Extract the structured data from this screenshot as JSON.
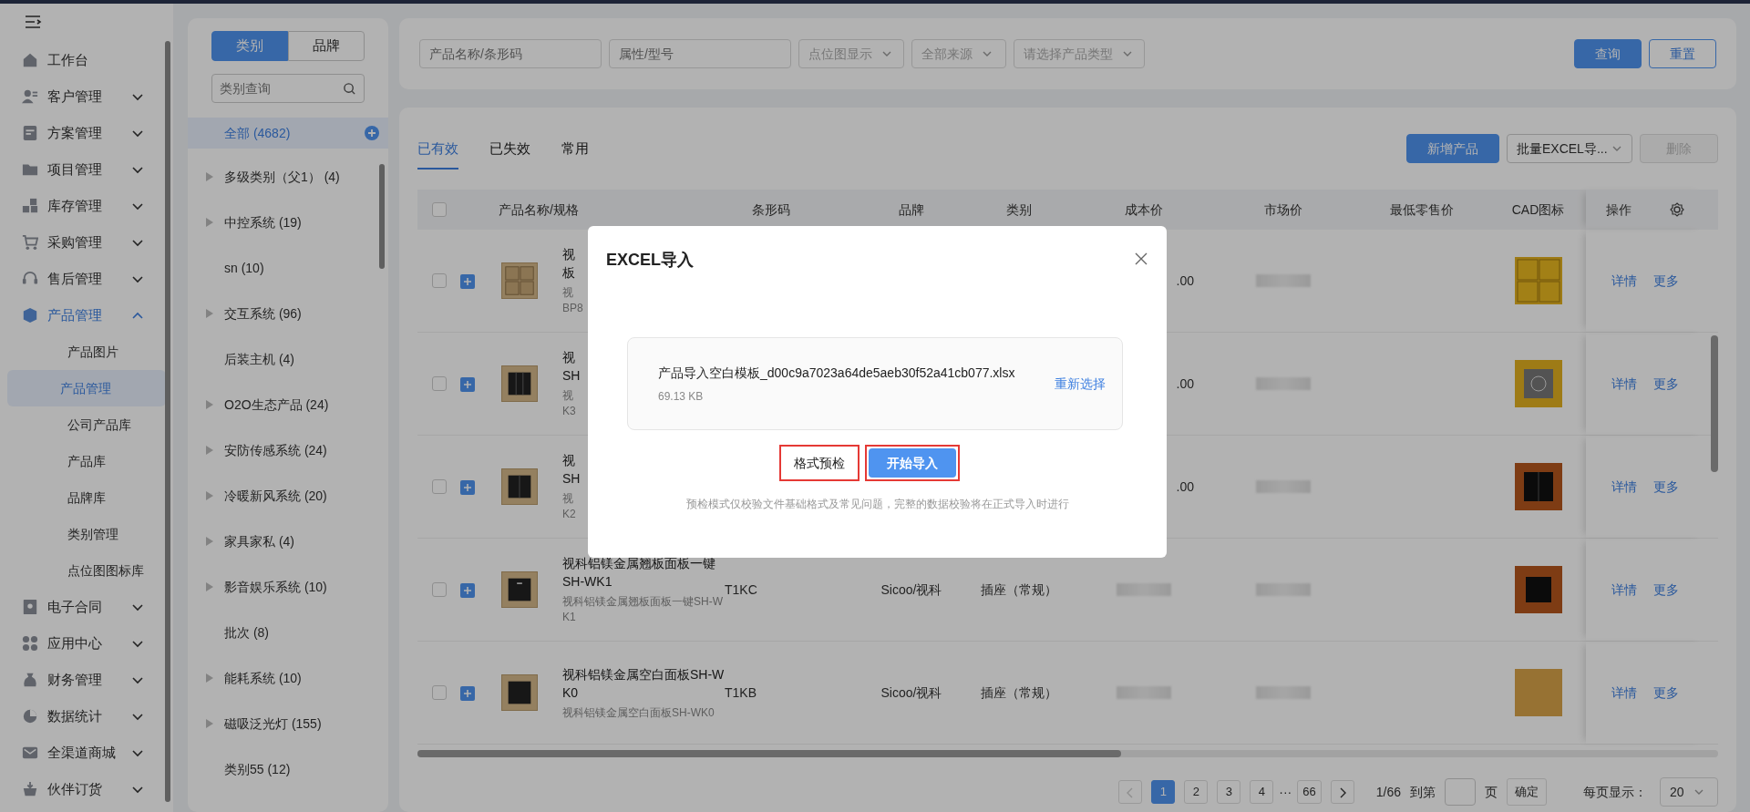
{
  "sidebar": {
    "items": [
      {
        "label": "工作台",
        "expandable": false,
        "active": false
      },
      {
        "label": "客户管理",
        "expandable": true,
        "expanded": false,
        "active": false
      },
      {
        "label": "方案管理",
        "expandable": true,
        "expanded": false,
        "active": false
      },
      {
        "label": "项目管理",
        "expandable": true,
        "expanded": false,
        "active": false
      },
      {
        "label": "库存管理",
        "expandable": true,
        "expanded": false,
        "active": false
      },
      {
        "label": "采购管理",
        "expandable": true,
        "expanded": false,
        "active": false
      },
      {
        "label": "售后管理",
        "expandable": true,
        "expanded": false,
        "active": false
      },
      {
        "label": "产品管理",
        "expandable": true,
        "expanded": true,
        "active": true,
        "children": [
          {
            "label": "产品图片",
            "selected": false
          },
          {
            "label": "产品管理",
            "selected": true
          },
          {
            "label": "公司产品库",
            "selected": false
          },
          {
            "label": "产品库",
            "selected": false
          },
          {
            "label": "品牌库",
            "selected": false
          },
          {
            "label": "类别管理",
            "selected": false
          },
          {
            "label": "点位图图标库",
            "selected": false
          }
        ]
      },
      {
        "label": "电子合同",
        "expandable": true,
        "expanded": false,
        "active": false
      },
      {
        "label": "应用中心",
        "expandable": true,
        "expanded": false,
        "active": false
      },
      {
        "label": "财务管理",
        "expandable": true,
        "expanded": false,
        "active": false
      },
      {
        "label": "数据统计",
        "expandable": true,
        "expanded": false,
        "active": false
      },
      {
        "label": "全渠道商城",
        "expandable": true,
        "expanded": false,
        "active": false
      },
      {
        "label": "伙伴订货",
        "expandable": true,
        "expanded": false,
        "active": false
      }
    ]
  },
  "category_panel": {
    "tabs": [
      {
        "label": "类别",
        "selected": true
      },
      {
        "label": "品牌",
        "selected": false
      }
    ],
    "search": {
      "placeholder": "类别查询"
    },
    "items": [
      {
        "label": "全部 (4682)",
        "expandable": false,
        "selected": true
      },
      {
        "label": "多级类别（父1） (4)",
        "expandable": true,
        "selected": false
      },
      {
        "label": "中控系统 (19)",
        "expandable": true,
        "selected": false
      },
      {
        "label": "sn (10)",
        "expandable": false,
        "selected": false
      },
      {
        "label": "交互系统 (96)",
        "expandable": true,
        "selected": false
      },
      {
        "label": "后装主机 (4)",
        "expandable": false,
        "selected": false
      },
      {
        "label": "O2O生态产品 (24)",
        "expandable": true,
        "selected": false
      },
      {
        "label": "安防传感系统 (24)",
        "expandable": true,
        "selected": false
      },
      {
        "label": "冷暖新风系统 (20)",
        "expandable": true,
        "selected": false
      },
      {
        "label": "家具家私 (4)",
        "expandable": true,
        "selected": false
      },
      {
        "label": "影音娱乐系统 (10)",
        "expandable": true,
        "selected": false
      },
      {
        "label": "批次 (8)",
        "expandable": false,
        "selected": false
      },
      {
        "label": "能耗系统 (10)",
        "expandable": true,
        "selected": false
      },
      {
        "label": "磁吸泛光灯 (155)",
        "expandable": true,
        "selected": false
      },
      {
        "label": "类别55 (12)",
        "expandable": false,
        "selected": false
      }
    ]
  },
  "filters": {
    "fields": [
      {
        "kind": "input",
        "placeholder": "产品名称/条形码"
      },
      {
        "kind": "input",
        "placeholder": "属性/型号"
      },
      {
        "kind": "select",
        "placeholder": "点位图显示"
      },
      {
        "kind": "select",
        "placeholder": "全部来源"
      },
      {
        "kind": "select",
        "placeholder": "请选择产品类型"
      }
    ],
    "buttons": [
      {
        "kind": "primary",
        "label": "查询"
      },
      {
        "kind": "outline",
        "label": "重置"
      }
    ]
  },
  "tabs": [
    {
      "label": "已有效",
      "selected": true
    },
    {
      "label": "已失效",
      "selected": false
    },
    {
      "label": "常用",
      "selected": false
    }
  ],
  "toolbar": {
    "buttons": [
      {
        "kind": "primary",
        "label": "新增产品",
        "disabled": false
      },
      {
        "kind": "select",
        "label": "批量EXCEL导...",
        "disabled": false
      },
      {
        "kind": "outline",
        "label": "删除",
        "disabled": true
      }
    ]
  },
  "table": {
    "header_checkbox": {
      "checked": false
    },
    "columns": [
      "产品名称/规格",
      "条形码",
      "品牌",
      "类别",
      "成本价",
      "市场价",
      "最低零售价",
      "CAD图标",
      "操作"
    ],
    "rows": [
      {
        "checked": false,
        "name_lines": [
          "视",
          "板"
        ],
        "sub_lines": [
          "视",
          "BP8"
        ],
        "cost": ".00",
        "cost_blurred": false,
        "market_blurred": true,
        "actions": [
          "详情",
          "更多"
        ]
      },
      {
        "checked": false,
        "name_lines": [
          "视",
          "SH"
        ],
        "sub_lines": [
          "视",
          "K3"
        ],
        "cost": ".00",
        "cost_blurred": false,
        "market_blurred": true,
        "actions": [
          "详情",
          "更多"
        ]
      },
      {
        "checked": false,
        "name_lines": [
          "视",
          "SH"
        ],
        "sub_lines": [
          "视",
          "K2"
        ],
        "cost": ".00",
        "cost_blurred": false,
        "market_blurred": true,
        "actions": [
          "详情",
          "更多"
        ]
      },
      {
        "checked": false,
        "name_lines": [
          "视科铝镁金属翘板面板一键",
          "SH-WK1"
        ],
        "sub_lines": [
          "视科铝镁金属翘板面板一键SH-W",
          "K1"
        ],
        "barcode": "T1KC",
        "brand": "Sicoo/视科",
        "category": "插座（常规）",
        "cost_blurred": true,
        "market_blurred": true,
        "actions": [
          "详情",
          "更多"
        ]
      },
      {
        "checked": false,
        "name_lines": [
          "视科铝镁金属空白面板SH-W",
          "K0"
        ],
        "sub_lines": [
          "视科铝镁金属空白面板SH-WK0"
        ],
        "barcode": "T1KB",
        "brand": "Sicoo/视科",
        "category": "插座（常规）",
        "cost_blurred": true,
        "market_blurred": true,
        "actions": [
          "详情",
          "更多"
        ]
      }
    ]
  },
  "pagination": {
    "prev_disabled": true,
    "pages": [
      {
        "kind": "page",
        "label": "1",
        "selected": true
      },
      {
        "kind": "page",
        "label": "2",
        "selected": false
      },
      {
        "kind": "page",
        "label": "3",
        "selected": false
      },
      {
        "kind": "page",
        "label": "4",
        "selected": false
      }
    ],
    "ellipsis": "···",
    "last_page": {
      "label": "66",
      "selected": false
    },
    "page_info": "1/66",
    "goto_label": "到第",
    "goto_suffix": "页",
    "confirm": "确定",
    "page_size_label": "每页显示：",
    "page_size": "20"
  },
  "modal": {
    "title": "EXCEL导入",
    "file": {
      "name": "产品导入空白模板_d00c9a7023a64de5aeb30f52a41cb077.xlsx",
      "size": "69.13 KB",
      "action": "重新选择"
    },
    "buttons": [
      {
        "kind": "outline",
        "label": "格式预检",
        "highlighted": true
      },
      {
        "kind": "primary",
        "label": "开始导入",
        "highlighted": true
      }
    ],
    "hint": "预检模式仅校验文件基础格式及常见问题，完整的数据校验将在正式导入时进行"
  }
}
